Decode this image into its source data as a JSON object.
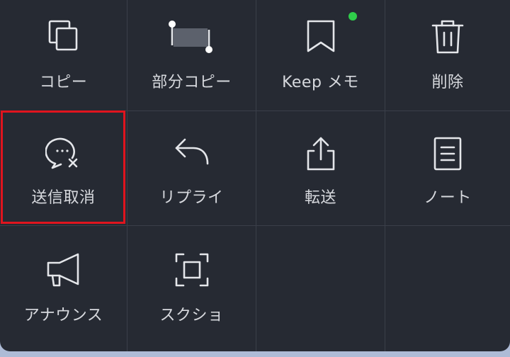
{
  "menu": {
    "items": [
      {
        "label": "コピー",
        "icon": "copy-icon"
      },
      {
        "label": "部分コピー",
        "icon": "partial-copy-icon"
      },
      {
        "label": "Keep メモ",
        "icon": "bookmark-icon"
      },
      {
        "label": "削除",
        "icon": "trash-icon"
      },
      {
        "label": "送信取消",
        "icon": "unsend-icon"
      },
      {
        "label": "リプライ",
        "icon": "reply-icon"
      },
      {
        "label": "転送",
        "icon": "share-icon"
      },
      {
        "label": "ノート",
        "icon": "note-icon"
      },
      {
        "label": "アナウンス",
        "icon": "megaphone-icon"
      },
      {
        "label": "スクショ",
        "icon": "screenshot-icon"
      }
    ]
  },
  "colors": {
    "background": "#262a33",
    "grid_line": "#3a3f49",
    "text": "#d7d9de",
    "highlight": "#e0141e",
    "badge": "#2fcd4a"
  }
}
